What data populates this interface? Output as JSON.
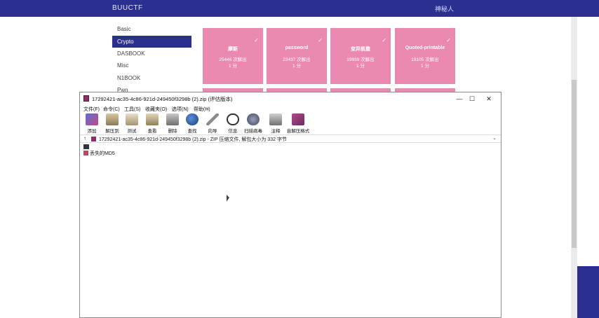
{
  "site": {
    "brand": "BUUCTF",
    "user": "神秘人"
  },
  "categories": [
    "Basic",
    "Crypto",
    "DASBOOK",
    "Misc",
    "N1BOOK",
    "Pwn"
  ],
  "active_category": "Crypto",
  "cards": [
    {
      "name": "摩斯",
      "solves": "25446 次解出",
      "points": "1 分"
    },
    {
      "name": "password",
      "solves": "23437 次解出",
      "points": "1 分"
    },
    {
      "name": "变异凯撒",
      "solves": "19939 次解出",
      "points": "1 分"
    },
    {
      "name": "Quoted-printable",
      "solves": "19105 次解出",
      "points": "1 分"
    }
  ],
  "colors": {
    "navbar": "#2b2f8f",
    "card": "#ec89b1",
    "archive_icon": "#8b2e6a"
  },
  "archive": {
    "title": "17292421-ac35-4c86-921d-249450f3298b (2).zip (评估版本)",
    "window_buttons": [
      "—",
      "☐",
      "✕"
    ],
    "menu": [
      "文件(F)",
      "命令(C)",
      "工具(S)",
      "收藏夹(O)",
      "选项(N)",
      "帮助(H)"
    ],
    "toolbar": [
      {
        "label": "添加",
        "icon": "add-icon"
      },
      {
        "label": "解压到",
        "icon": "extract-icon"
      },
      {
        "label": "测试",
        "icon": "test-icon"
      },
      {
        "label": "查看",
        "icon": "view-icon"
      },
      {
        "label": "删除",
        "icon": "delete-icon"
      },
      {
        "label": "查找",
        "icon": "find-icon"
      },
      {
        "label": "向导",
        "icon": "wizard-icon"
      },
      {
        "label": "信息",
        "icon": "info-icon"
      },
      {
        "label": "扫描病毒",
        "icon": "scan-icon"
      },
      {
        "label": "注释",
        "icon": "comment-icon"
      },
      {
        "label": "自解压格式",
        "icon": "sfx-icon"
      }
    ],
    "address": "17292421-ac35-4c86-921d-249450f3298b (2).zip - ZIP 压缩文件, 解包大小为 332 字节",
    "files": [
      {
        "name": "丢失的MD5"
      }
    ]
  }
}
